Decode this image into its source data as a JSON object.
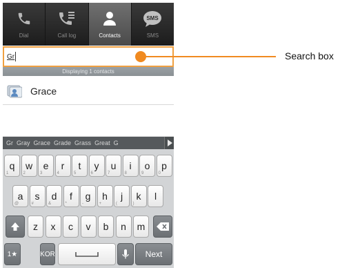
{
  "tabs": [
    {
      "label": "Dial",
      "icon": "phone-icon",
      "active": false
    },
    {
      "label": "Call log",
      "icon": "call-log-icon",
      "active": false
    },
    {
      "label": "Contacts",
      "icon": "person-icon",
      "active": true
    },
    {
      "label": "SMS",
      "icon": "sms-icon",
      "active": false,
      "badge": "SMS"
    }
  ],
  "search": {
    "value": "Gr"
  },
  "result_count": "Displaying 1 contacts",
  "contacts": [
    {
      "name": "Grace"
    }
  ],
  "suggestions": [
    "Gr",
    "Gray",
    "Grace",
    "Grade",
    "Grass",
    "Great",
    "G"
  ],
  "keyboard": {
    "row1": [
      [
        "q",
        "1"
      ],
      [
        "w",
        "2"
      ],
      [
        "e",
        "3"
      ],
      [
        "r",
        "4"
      ],
      [
        "t",
        "5"
      ],
      [
        "y",
        "6"
      ],
      [
        "u",
        "7"
      ],
      [
        "i",
        "8"
      ],
      [
        "o",
        "9"
      ],
      [
        "p",
        "0"
      ]
    ],
    "row2": [
      [
        "a",
        "@"
      ],
      [
        "s",
        "#"
      ],
      [
        "d",
        "&"
      ],
      [
        "f",
        "*"
      ],
      [
        "g",
        "-"
      ],
      [
        "h",
        "+"
      ],
      [
        "j",
        "("
      ],
      [
        "k",
        ")"
      ],
      [
        "l",
        ""
      ]
    ],
    "row3": [
      [
        "z",
        ""
      ],
      [
        "x",
        ""
      ],
      [
        "c",
        ""
      ],
      [
        "v",
        ""
      ],
      [
        "b",
        ""
      ],
      [
        "n",
        ""
      ],
      [
        "m",
        ""
      ]
    ],
    "sym_label": "1★",
    "lang_label": "KOR",
    "next_label": "Next"
  },
  "annotation": {
    "label": "Search box",
    "color": "#f08a20"
  }
}
